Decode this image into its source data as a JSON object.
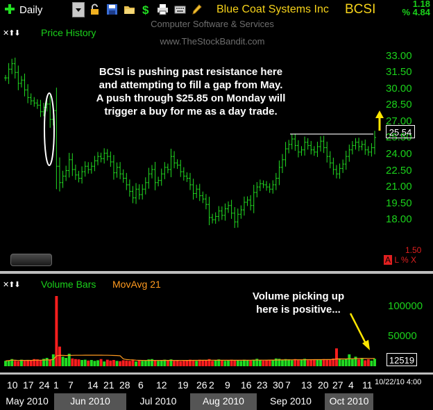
{
  "toolbar": {
    "period": "Daily",
    "symbol_name": "Blue Coat Systems Inc",
    "symbol": "BCSI",
    "change": "1.18",
    "pct_change": "% 4.84",
    "icons": [
      "plus-icon",
      "lock-icon",
      "save-icon",
      "open-icon",
      "dollar-icon",
      "print-icon",
      "keyboard-icon",
      "pencil-icon"
    ]
  },
  "watermark": {
    "line1": "Computer Software & Services",
    "line2": "www.TheStockBandit.com"
  },
  "price_panel": {
    "label": "Price History",
    "controls": "✕⬆⬇",
    "last_price": "25.54",
    "scale_ratio": "1.50",
    "scale_buttons": [
      "A",
      "L",
      "%",
      "X"
    ]
  },
  "volume_panel": {
    "label": "Volume Bars",
    "ma_label": "MovAvg 21",
    "controls": "✕⬆⬇",
    "last_volume": "12519"
  },
  "annotations": {
    "price_note": [
      "BCSI is pushing past resistance here",
      "and attempting to fill a gap from May.",
      "A push through $25.85 on Monday will",
      "trigger a buy for me as a day trade."
    ],
    "volume_note": [
      "Volume picking up",
      "here is positive..."
    ]
  },
  "date_stamp": "10/22/10 4:00",
  "colors": {
    "up": "#22dd22",
    "down": "#ff1e1e",
    "axis": "#1bd11b",
    "ma": "#ff9a1f",
    "annotation": "#ffffff",
    "arrow": "#ffe600"
  },
  "chart_data": [
    {
      "type": "ohlc",
      "title": "Price History",
      "ylim": [
        16.8,
        34.0
      ],
      "y_ticks": [
        33.0,
        31.5,
        30.0,
        28.5,
        27.0,
        25.5,
        24.0,
        22.5,
        21.0,
        19.5,
        18.0
      ],
      "x_ticks": [
        "10",
        "17",
        "24",
        "1",
        "7",
        "14",
        "21",
        "28",
        "6",
        "12",
        "19",
        "26",
        "2",
        "9",
        "16",
        "23",
        "30",
        "7",
        "13",
        "20",
        "27",
        "4",
        "11"
      ],
      "months": [
        "May 2010",
        "Jun 2010",
        "Jul 2010",
        "Aug 2010",
        "Sep 2010",
        "Oct 2010"
      ],
      "close": [
        31.0,
        31.8,
        32.3,
        31.5,
        30.5,
        30.8,
        29.9,
        29.2,
        28.9,
        28.7,
        28.5,
        27.9,
        28.3,
        28.6,
        27.2,
        28.0,
        22.9,
        21.4,
        22.0,
        22.5,
        23.5,
        22.6,
        22.1,
        21.8,
        22.4,
        22.9,
        22.6,
        22.9,
        23.4,
        23.8,
        23.6,
        24.1,
        23.8,
        23.3,
        22.3,
        22.8,
        22.2,
        21.8,
        21.2,
        20.6,
        20.0,
        20.8,
        20.3,
        20.8,
        21.4,
        22.2,
        22.6,
        21.4,
        21.6,
        22.2,
        22.8,
        22.6,
        23.8,
        23.2,
        23.0,
        22.4,
        22.0,
        21.8,
        21.2,
        20.4,
        20.8,
        20.2,
        19.9,
        19.4,
        18.2,
        18.0,
        18.3,
        18.8,
        18.4,
        19.0,
        19.3,
        18.6,
        17.8,
        18.5,
        18.9,
        19.6,
        19.8,
        19.3,
        20.5,
        21.0,
        21.3,
        21.2,
        21.0,
        20.8,
        21.2,
        21.8,
        22.8,
        23.5,
        24.5,
        24.9,
        25.4,
        24.8,
        24.2,
        24.4,
        25.1,
        24.8,
        24.4,
        24.2,
        24.7,
        25.2,
        24.6,
        23.8,
        23.2,
        22.6,
        22.2,
        22.7,
        23.1,
        23.8,
        24.4,
        24.8,
        25.1,
        24.7,
        24.9,
        24.4,
        24.2,
        24.6,
        25.54
      ],
      "resistance": 25.85
    },
    {
      "type": "bar",
      "title": "Volume Bars",
      "ylim": [
        0,
        125000
      ],
      "y_ticks": [
        100000,
        50000
      ],
      "ma_period": 21,
      "last": 12519,
      "volume": [
        9000,
        10000,
        12000,
        9000,
        8500,
        11000,
        9000,
        10500,
        9500,
        12000,
        11500,
        10000,
        12500,
        14000,
        11000,
        20000,
        118000,
        33000,
        16000,
        14000,
        21000,
        13000,
        12000,
        11500,
        10500,
        11000,
        9500,
        10500,
        9000,
        10000,
        12000,
        8000,
        11000,
        9500,
        10500,
        9000,
        8500,
        10000,
        9500,
        9000,
        10500,
        8000,
        9500,
        9000,
        10000,
        11500,
        12000,
        9500,
        9000,
        10500,
        11000,
        9500,
        11500,
        9000,
        10000,
        8500,
        9000,
        9500,
        11000,
        10500,
        9000,
        11000,
        9500,
        10000,
        12000,
        9000,
        10500,
        11500,
        10000,
        9000,
        10500,
        11000,
        9500,
        10000,
        9000,
        11000,
        10500,
        9500,
        11000,
        12500,
        10000,
        9500,
        10500,
        11000,
        10000,
        13000,
        12500,
        11000,
        12000,
        11500,
        10000,
        12000,
        11000,
        10500,
        12500,
        10000,
        11000,
        11500,
        10500,
        11000,
        12000,
        11500,
        10500,
        13000,
        30000,
        12000,
        11000,
        12500,
        20000,
        12000,
        16000,
        11500,
        14000,
        10000,
        11500,
        9500,
        12519
      ]
    }
  ]
}
